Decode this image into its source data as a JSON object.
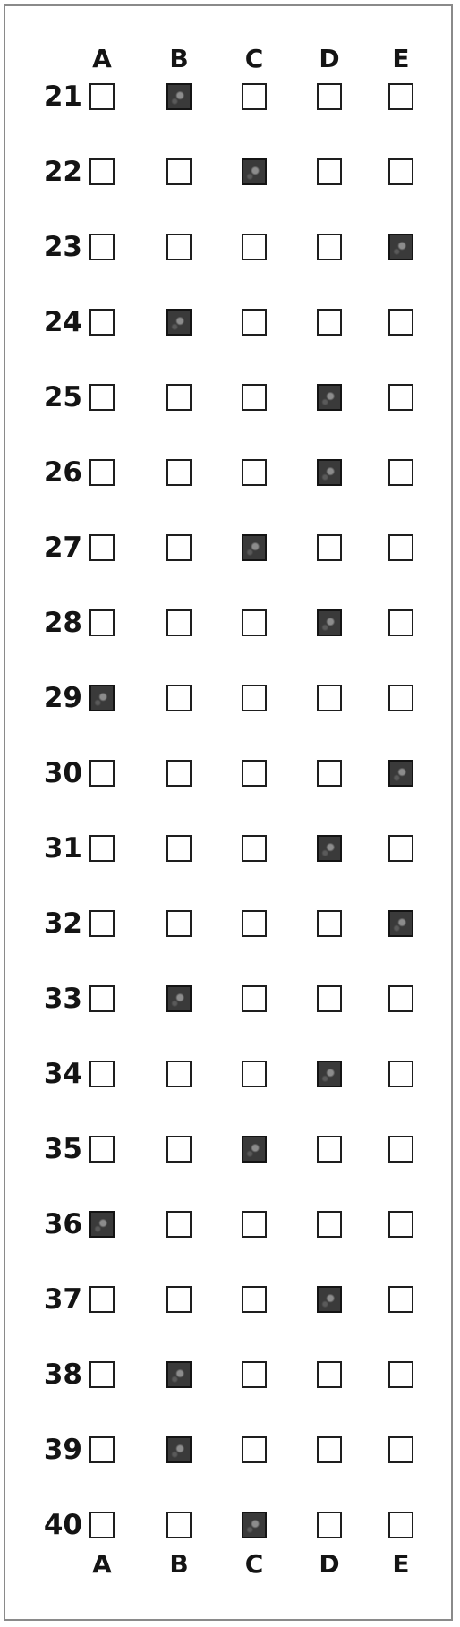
{
  "sheet": {
    "columns": [
      "A",
      "B",
      "C",
      "D",
      "E"
    ],
    "rows": [
      {
        "number": "21",
        "filled": "B"
      },
      {
        "number": "22",
        "filled": "C"
      },
      {
        "number": "23",
        "filled": "E"
      },
      {
        "number": "24",
        "filled": "B"
      },
      {
        "number": "25",
        "filled": "D"
      },
      {
        "number": "26",
        "filled": "D"
      },
      {
        "number": "27",
        "filled": "C"
      },
      {
        "number": "28",
        "filled": "D"
      },
      {
        "number": "29",
        "filled": "A"
      },
      {
        "number": "30",
        "filled": "E"
      },
      {
        "number": "31",
        "filled": "D"
      },
      {
        "number": "32",
        "filled": "E"
      },
      {
        "number": "33",
        "filled": "B"
      },
      {
        "number": "34",
        "filled": "D"
      },
      {
        "number": "35",
        "filled": "C"
      },
      {
        "number": "36",
        "filled": "A"
      },
      {
        "number": "37",
        "filled": "D"
      },
      {
        "number": "38",
        "filled": "B"
      },
      {
        "number": "39",
        "filled": "B"
      },
      {
        "number": "40",
        "filled": "C"
      }
    ]
  }
}
